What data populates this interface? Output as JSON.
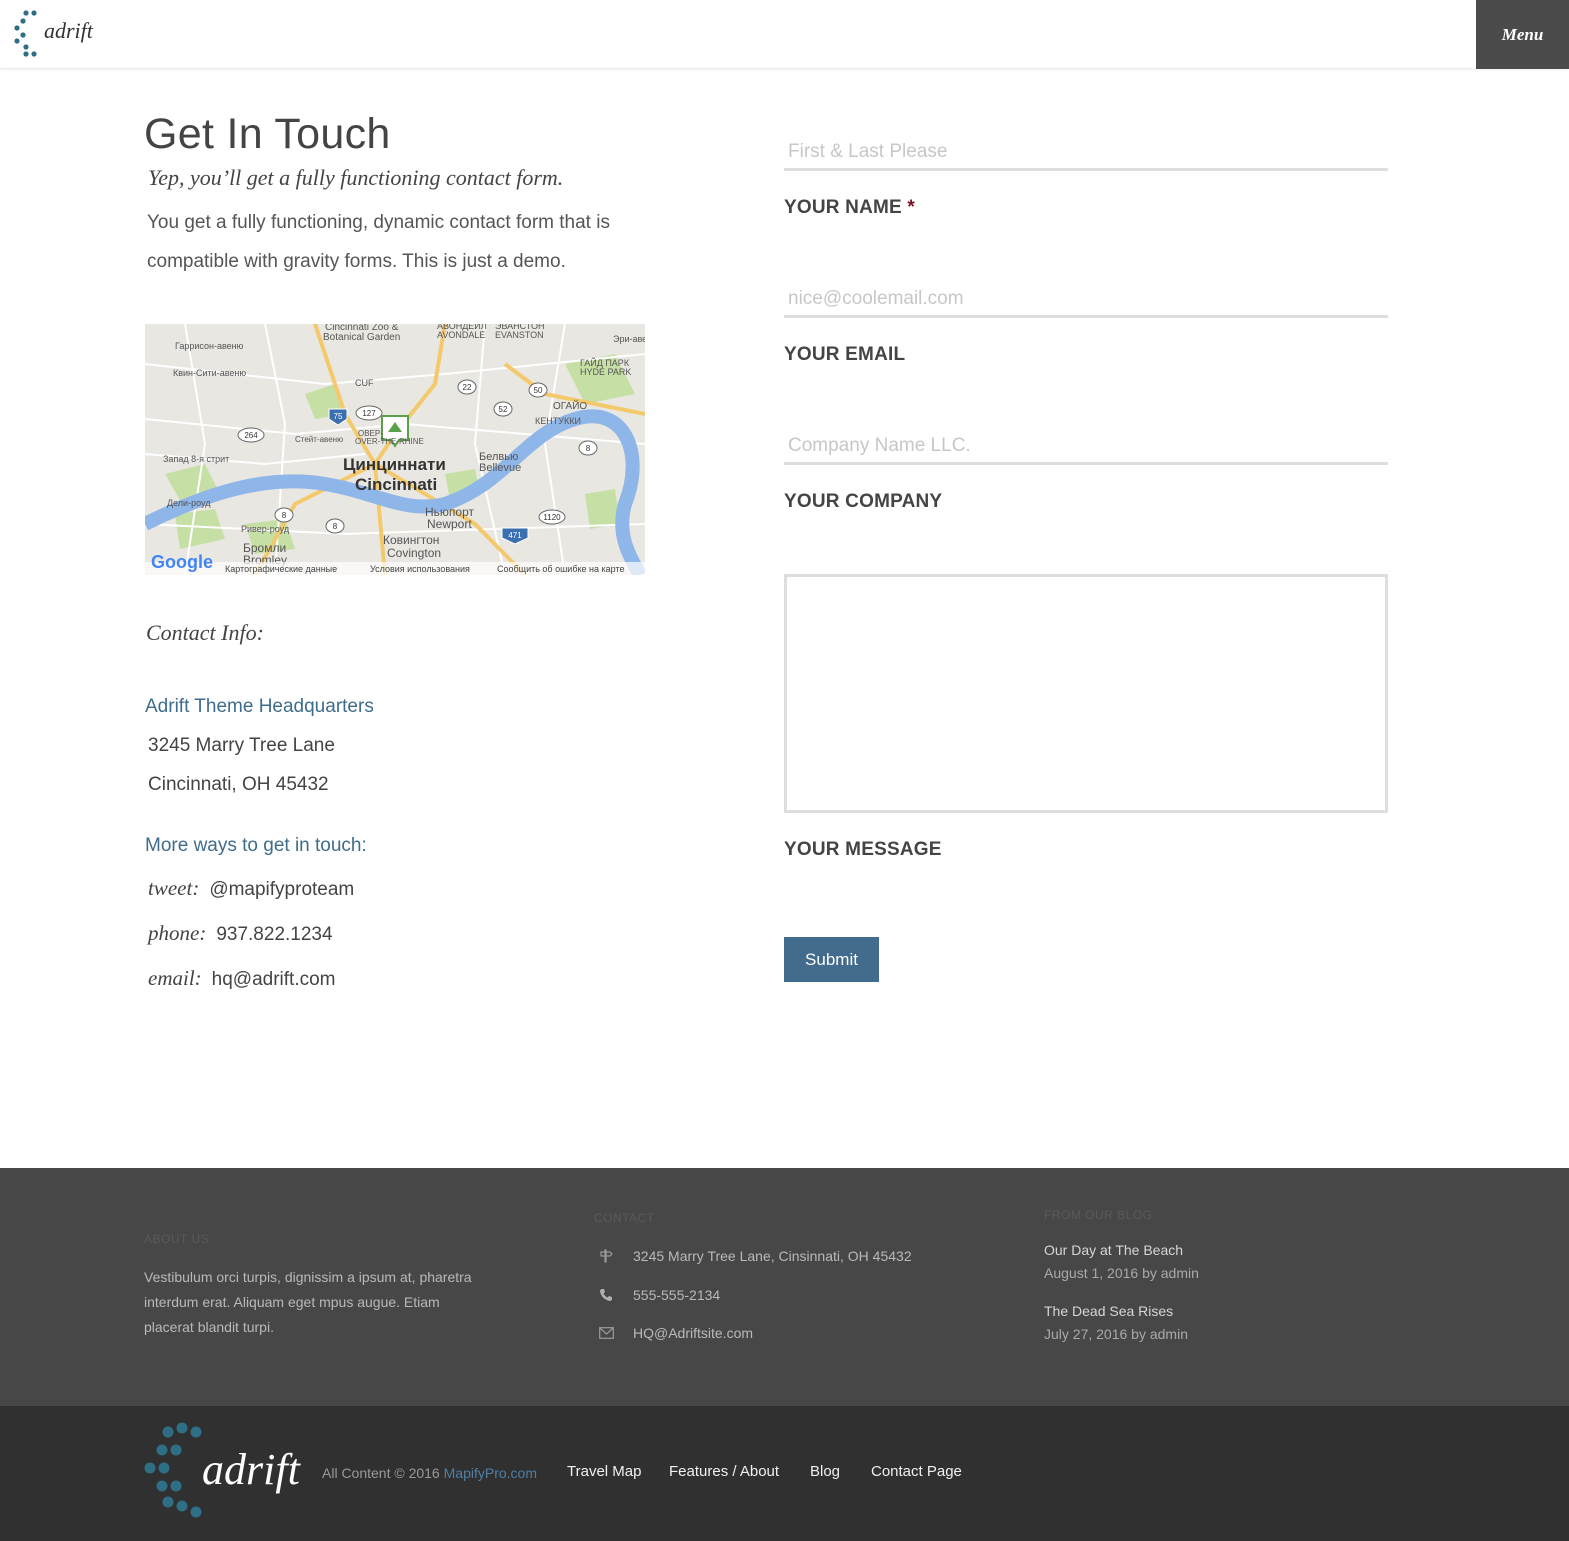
{
  "header": {
    "brand": "adrift",
    "menu_label": "Menu"
  },
  "main": {
    "title": "Get In Touch",
    "subtitle": "Yep, you’ll get a fully functioning contact form.",
    "intro": "You get a fully functioning, dynamic contact form that is compatible with gravity forms. This is just a demo.",
    "map": {
      "labels": [
        "Cincinnati Zoo &",
        "Botanical Garden",
        "АВОНДЕЙЛ",
        "AVONDALE",
        "ЭВАНСТОН",
        "EVANSTON",
        "Эри-аве",
        "Гаррисон-авеню",
        "Квин-Сити-авеню",
        "ГАЙД ПАРК",
        "HYDE PARK",
        "CUF",
        "ОГАЙО",
        "КЕНТУККИ",
        "Стейт-авеню",
        "ОВЕР-",
        "OVER-THE-RHINE",
        "Запад 8-я стрит",
        "Цинциннати",
        "Cincinnati",
        "Белвью",
        "Bellevue",
        "Дели-роуд",
        "Ривер-роуд",
        "Ньюпорт",
        "Newport",
        "Ковингтон",
        "Covington",
        "Бромли",
        "Bromley"
      ],
      "shields": [
        "75",
        "127",
        "22",
        "50",
        "52",
        "264",
        "8",
        "8",
        "8",
        "1120",
        "471"
      ],
      "attribution_logo": "Google",
      "attribution": [
        "Картографические данные",
        "Условия использования",
        "Сообщить об ошибке на карте"
      ]
    },
    "contact_heading": "Contact Info:",
    "hq_name": "Adrift Theme Headquarters",
    "address_line1": "3245 Marry Tree Lane",
    "address_line2": "Cincinnati, OH 45432",
    "more_ways": "More ways to get in touch:",
    "ways": [
      {
        "label": "tweet:",
        "value": "@mapifyproteam"
      },
      {
        "label": "phone:",
        "value": "937.822.1234"
      },
      {
        "label": "email:",
        "value": "hq@adrift.com"
      }
    ]
  },
  "form": {
    "name": {
      "placeholder": "First & Last Please",
      "label": "YOUR NAME",
      "required_mark": "*"
    },
    "email": {
      "placeholder": "nice@coolemail.com",
      "label": "YOUR EMAIL"
    },
    "company": {
      "placeholder": "Company Name LLC.",
      "label": "YOUR COMPANY"
    },
    "message": {
      "label": "YOUR MESSAGE"
    },
    "submit_label": "Submit"
  },
  "footer_widgets": {
    "about": {
      "heading": "ABOUT US",
      "text": "Vestibulum orci turpis, dignissim a ipsum at, pharetra interdum erat. Aliquam eget mpus augue. Etiam placerat blandit turpi."
    },
    "contact": {
      "heading": "CONTACT",
      "address": "3245 Marry Tree Lane, Cinsinnati, OH 45432",
      "phone": "555-555-2134",
      "email": "HQ@Adriftsite.com"
    },
    "blog": {
      "heading": "FROM OUR BLOG",
      "posts": [
        {
          "title": "Our Day at The Beach",
          "meta": "August 1, 2016 by admin"
        },
        {
          "title": "The Dead Sea Rises",
          "meta": "July 27, 2016 by admin"
        }
      ]
    }
  },
  "footer_bottom": {
    "brand": "adrift",
    "copyright_prefix": "All Content © 2016 ",
    "copyright_link": "MapifyPro.com",
    "nav": [
      "Travel Map",
      "Features / About",
      "Blog",
      "Contact Page"
    ]
  },
  "colors": {
    "accent": "#426b8d",
    "link": "#3e6d8c",
    "logo_dots": "#2f6f86",
    "footer_top": "#474747",
    "footer_bottom": "#303030"
  }
}
